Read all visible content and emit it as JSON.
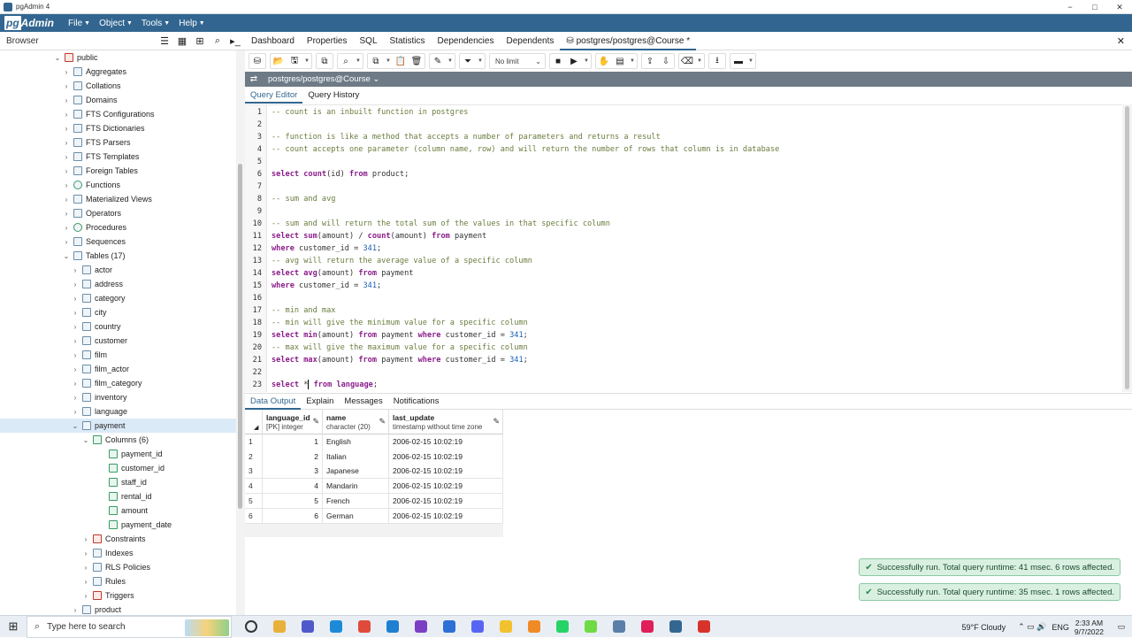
{
  "window": {
    "title": "pgAdmin 4",
    "controls": [
      "−",
      "□",
      "✕"
    ]
  },
  "menubar": {
    "logo_box": "pg",
    "logo_rest": "Admin",
    "menus": [
      "File",
      "Object",
      "Tools",
      "Help"
    ]
  },
  "browser": {
    "label": "Browser",
    "tree": [
      {
        "label": "public",
        "indent": 0,
        "chev": "⌄",
        "icon": "schema-icon"
      },
      {
        "label": "Aggregates",
        "indent": 1,
        "chev": "›",
        "icon": "aggregate-icon"
      },
      {
        "label": "Collations",
        "indent": 1,
        "chev": "›",
        "icon": "collation-icon"
      },
      {
        "label": "Domains",
        "indent": 1,
        "chev": "›",
        "icon": "domain-icon"
      },
      {
        "label": "FTS Configurations",
        "indent": 1,
        "chev": "›",
        "icon": "fts-config-icon"
      },
      {
        "label": "FTS Dictionaries",
        "indent": 1,
        "chev": "›",
        "icon": "fts-dictionary-icon"
      },
      {
        "label": "FTS Parsers",
        "indent": 1,
        "chev": "›",
        "icon": "fts-parser-icon"
      },
      {
        "label": "FTS Templates",
        "indent": 1,
        "chev": "›",
        "icon": "fts-template-icon"
      },
      {
        "label": "Foreign Tables",
        "indent": 1,
        "chev": "›",
        "icon": "foreign-table-icon"
      },
      {
        "label": "Functions",
        "indent": 1,
        "chev": "›",
        "icon": "function-icon"
      },
      {
        "label": "Materialized Views",
        "indent": 1,
        "chev": "›",
        "icon": "materialized-view-icon"
      },
      {
        "label": "Operators",
        "indent": 1,
        "chev": "›",
        "icon": "operator-icon"
      },
      {
        "label": "Procedures",
        "indent": 1,
        "chev": "›",
        "icon": "procedure-icon"
      },
      {
        "label": "Sequences",
        "indent": 1,
        "chev": "›",
        "icon": "sequence-icon"
      },
      {
        "label": "Tables (17)",
        "indent": 1,
        "chev": "⌄",
        "icon": "tables-icon"
      },
      {
        "label": "actor",
        "indent": 2,
        "chev": "›",
        "icon": "table-icon"
      },
      {
        "label": "address",
        "indent": 2,
        "chev": "›",
        "icon": "table-icon"
      },
      {
        "label": "category",
        "indent": 2,
        "chev": "›",
        "icon": "table-icon"
      },
      {
        "label": "city",
        "indent": 2,
        "chev": "›",
        "icon": "table-icon"
      },
      {
        "label": "country",
        "indent": 2,
        "chev": "›",
        "icon": "table-icon"
      },
      {
        "label": "customer",
        "indent": 2,
        "chev": "›",
        "icon": "table-icon"
      },
      {
        "label": "film",
        "indent": 2,
        "chev": "›",
        "icon": "table-icon"
      },
      {
        "label": "film_actor",
        "indent": 2,
        "chev": "›",
        "icon": "table-icon"
      },
      {
        "label": "film_category",
        "indent": 2,
        "chev": "›",
        "icon": "table-icon"
      },
      {
        "label": "inventory",
        "indent": 2,
        "chev": "›",
        "icon": "table-icon"
      },
      {
        "label": "language",
        "indent": 2,
        "chev": "›",
        "icon": "table-icon"
      },
      {
        "label": "payment",
        "indent": 2,
        "chev": "⌄",
        "icon": "table-icon",
        "selected": true
      },
      {
        "label": "Columns (6)",
        "indent": 3,
        "chev": "⌄",
        "icon": "columns-icon"
      },
      {
        "label": "payment_id",
        "indent": 4,
        "chev": "",
        "icon": "column-icon"
      },
      {
        "label": "customer_id",
        "indent": 4,
        "chev": "",
        "icon": "column-icon"
      },
      {
        "label": "staff_id",
        "indent": 4,
        "chev": "",
        "icon": "column-icon"
      },
      {
        "label": "rental_id",
        "indent": 4,
        "chev": "",
        "icon": "column-icon"
      },
      {
        "label": "amount",
        "indent": 4,
        "chev": "",
        "icon": "column-icon"
      },
      {
        "label": "payment_date",
        "indent": 4,
        "chev": "",
        "icon": "column-icon"
      },
      {
        "label": "Constraints",
        "indent": 3,
        "chev": "›",
        "icon": "constraint-icon"
      },
      {
        "label": "Indexes",
        "indent": 3,
        "chev": "›",
        "icon": "index-icon"
      },
      {
        "label": "RLS Policies",
        "indent": 3,
        "chev": "›",
        "icon": "rls-policy-icon"
      },
      {
        "label": "Rules",
        "indent": 3,
        "chev": "›",
        "icon": "rule-icon"
      },
      {
        "label": "Triggers",
        "indent": 3,
        "chev": "›",
        "icon": "trigger-icon"
      },
      {
        "label": "product",
        "indent": 2,
        "chev": "›",
        "icon": "table-icon"
      }
    ]
  },
  "tabs": [
    "Dashboard",
    "Properties",
    "SQL",
    "Statistics",
    "Dependencies",
    "Dependents"
  ],
  "active_tab": "postgres/postgres@Course *",
  "toolbar": {
    "limit": "No limit"
  },
  "connection": {
    "name": "postgres/postgres@Course"
  },
  "query_tabs": [
    "Query Editor",
    "Query History"
  ],
  "editor": {
    "lines": [
      {
        "n": "1",
        "t": [
          [
            "cm",
            "-- count is an inbuilt function in postgres"
          ]
        ]
      },
      {
        "n": "2",
        "t": []
      },
      {
        "n": "3",
        "t": [
          [
            "cm",
            "-- function is like a method that accepts a number of parameters and returns a result"
          ]
        ]
      },
      {
        "n": "4",
        "t": [
          [
            "cm",
            "-- count accepts one parameter (column name, row) and will return the number of rows that column is in database"
          ]
        ]
      },
      {
        "n": "5",
        "t": []
      },
      {
        "n": "6",
        "t": [
          [
            "kw",
            "select "
          ],
          [
            "fn",
            "count"
          ],
          [
            "op",
            "(id) "
          ],
          [
            "kw",
            "from"
          ],
          [
            "op",
            " product;"
          ]
        ]
      },
      {
        "n": "7",
        "t": []
      },
      {
        "n": "8",
        "t": [
          [
            "cm",
            "-- sum and avg"
          ]
        ]
      },
      {
        "n": "9",
        "t": []
      },
      {
        "n": "10",
        "t": [
          [
            "cm",
            "-- sum and will return the total sum of the values in that specific column"
          ]
        ]
      },
      {
        "n": "11",
        "t": [
          [
            "kw",
            "select "
          ],
          [
            "fn",
            "sum"
          ],
          [
            "op",
            "(amount) / "
          ],
          [
            "fn",
            "count"
          ],
          [
            "op",
            "(amount) "
          ],
          [
            "kw",
            "from"
          ],
          [
            "op",
            " payment"
          ]
        ]
      },
      {
        "n": "12",
        "t": [
          [
            "kw",
            "where"
          ],
          [
            "op",
            " customer_id = "
          ],
          [
            "num",
            "341"
          ],
          [
            "op",
            ";"
          ]
        ]
      },
      {
        "n": "13",
        "t": [
          [
            "cm",
            "-- avg will return the average value of a specific column"
          ]
        ]
      },
      {
        "n": "14",
        "t": [
          [
            "kw",
            "select "
          ],
          [
            "fn",
            "avg"
          ],
          [
            "op",
            "(amount) "
          ],
          [
            "kw",
            "from"
          ],
          [
            "op",
            " payment"
          ]
        ]
      },
      {
        "n": "15",
        "t": [
          [
            "kw",
            "where"
          ],
          [
            "op",
            " customer_id = "
          ],
          [
            "num",
            "341"
          ],
          [
            "op",
            ";"
          ]
        ]
      },
      {
        "n": "16",
        "t": []
      },
      {
        "n": "17",
        "t": [
          [
            "cm",
            "-- min and max"
          ]
        ]
      },
      {
        "n": "18",
        "t": [
          [
            "cm",
            "-- min will give the minimum value for a specific column"
          ]
        ]
      },
      {
        "n": "19",
        "t": [
          [
            "kw",
            "select "
          ],
          [
            "fn",
            "min"
          ],
          [
            "op",
            "(amount) "
          ],
          [
            "kw",
            "from"
          ],
          [
            "op",
            " payment "
          ],
          [
            "kw",
            "where"
          ],
          [
            "op",
            " customer_id = "
          ],
          [
            "num",
            "341"
          ],
          [
            "op",
            ";"
          ]
        ]
      },
      {
        "n": "20",
        "t": [
          [
            "cm",
            "-- max will give the maximum value for a specific column"
          ]
        ]
      },
      {
        "n": "21",
        "t": [
          [
            "kw",
            "select "
          ],
          [
            "fn",
            "max"
          ],
          [
            "op",
            "(amount) "
          ],
          [
            "kw",
            "from"
          ],
          [
            "op",
            " payment "
          ],
          [
            "kw",
            "where"
          ],
          [
            "op",
            " customer_id = "
          ],
          [
            "num",
            "341"
          ],
          [
            "op",
            ";"
          ]
        ]
      },
      {
        "n": "22",
        "t": []
      },
      {
        "n": "23",
        "t": [
          [
            "kw",
            "select "
          ],
          [
            "op",
            "*"
          ],
          [
            "cursor",
            ""
          ],
          [
            "kw",
            " from "
          ],
          [
            "kw",
            "language"
          ],
          [
            "op",
            ";"
          ]
        ]
      }
    ]
  },
  "output_tabs": [
    "Data Output",
    "Explain",
    "Messages",
    "Notifications"
  ],
  "grid": {
    "columns": [
      {
        "name": "language_id",
        "type": "[PK] integer"
      },
      {
        "name": "name",
        "type": "character (20)"
      },
      {
        "name": "last_update",
        "type": "timestamp without time zone"
      }
    ],
    "rows": [
      [
        "1",
        "1",
        "English",
        "2006-02-15 10:02:19"
      ],
      [
        "2",
        "2",
        "Italian",
        "2006-02-15 10:02:19"
      ],
      [
        "3",
        "3",
        "Japanese",
        "2006-02-15 10:02:19"
      ],
      [
        "4",
        "4",
        "Mandarin",
        "2006-02-15 10:02:19"
      ],
      [
        "5",
        "5",
        "French",
        "2006-02-15 10:02:19"
      ],
      [
        "6",
        "6",
        "German",
        "2006-02-15 10:02:19"
      ]
    ]
  },
  "toasts": [
    "Successfully run. Total query runtime: 41 msec. 6 rows affected.",
    "Successfully run. Total query runtime: 35 msec. 1 rows affected."
  ],
  "taskbar": {
    "search_placeholder": "Type here to search",
    "weather": "59°F  Cloudy",
    "lang": "ENG",
    "time": "2:33 AM",
    "date": "9/7/2022",
    "apps": [
      "task-view",
      "file-explorer",
      "ms-teams",
      "edge",
      "chrome",
      "vscode",
      "visual-studio",
      "app-blue",
      "discord",
      "app-yellow",
      "app-orange",
      "whatsapp",
      "upwork",
      "notepad",
      "slack",
      "pgadmin",
      "app-red"
    ]
  },
  "colors": {
    "brand": "#326690",
    "selected_row": "#dbeaf7",
    "toast_bg": "#d9f0e1"
  }
}
